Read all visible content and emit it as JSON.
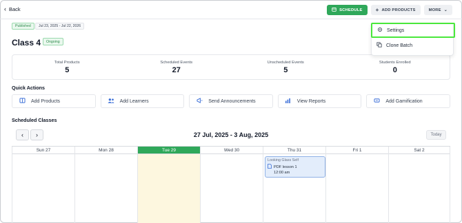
{
  "header": {
    "back_label": "Back",
    "schedule_label": "SCHEDULE",
    "add_products_label": "ADD PRODUCTS",
    "more_label": "MORE"
  },
  "batch": {
    "status": "Published",
    "date_range": "Jul 23, 2025 - Jul 22, 2026",
    "title": "Class 4",
    "state": "Ongoing"
  },
  "menu": {
    "items": [
      {
        "label": "Settings",
        "icon": "gear-icon"
      },
      {
        "label": "Clone Batch",
        "icon": "copy-icon"
      }
    ]
  },
  "stats": [
    {
      "label": "Total Products",
      "value": "5"
    },
    {
      "label": "Scheduled Events",
      "value": "27"
    },
    {
      "label": "Unscheduled Events",
      "value": "5"
    },
    {
      "label": "Students Enrolled",
      "value": "0"
    }
  ],
  "quick_actions": {
    "title": "Quick Actions",
    "items": [
      {
        "label": "Add Products",
        "icon": "book-icon"
      },
      {
        "label": "Add Learners",
        "icon": "users-icon"
      },
      {
        "label": "Send Announcements",
        "icon": "megaphone-icon"
      },
      {
        "label": "View Reports",
        "icon": "bar-chart-icon"
      },
      {
        "label": "Add Gamification",
        "icon": "ticket-icon"
      }
    ]
  },
  "calendar": {
    "title": "Scheduled Classes",
    "range": "27 Jul, 2025 - 3 Aug, 2025",
    "today_label": "Today",
    "days": [
      "Sun 27",
      "Mon 28",
      "Tue 29",
      "Wed 30",
      "Thu 31",
      "Fri 1",
      "Sat 2"
    ],
    "today_index": 2,
    "event": {
      "group": "Looking Glass Self",
      "name": "PDF lesson 1",
      "time": "12:00 am",
      "day_index": 4
    }
  },
  "colors": {
    "accent_green": "#2fa85a",
    "highlight": "#49e83a",
    "today_bg": "#fdf7df",
    "event_bg": "#e3edfb"
  }
}
